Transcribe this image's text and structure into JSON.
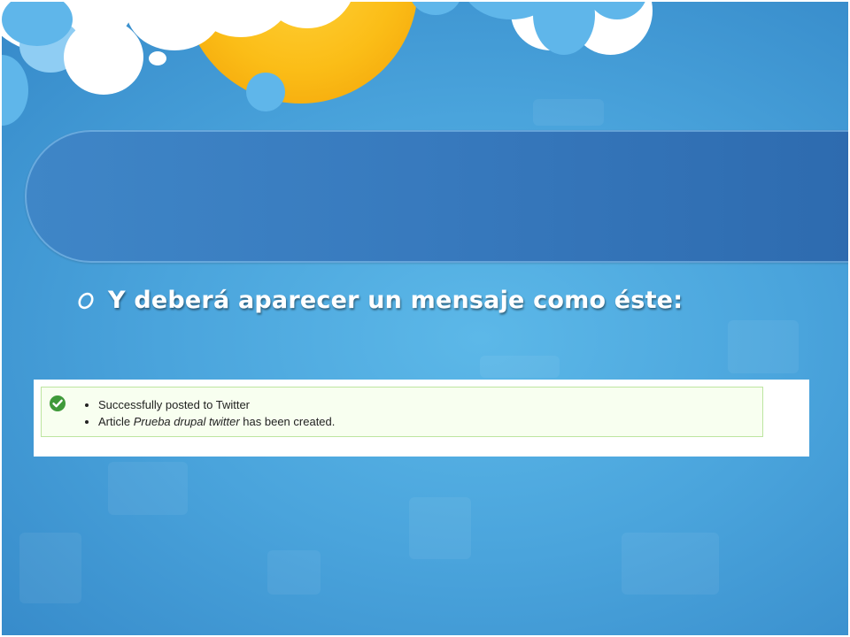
{
  "slide": {
    "bullet_text": "Y deberá aparecer un mensaje como éste:",
    "bullet_icon": "ring-bullet-icon"
  },
  "message": {
    "status_icon": "check-circle-icon",
    "items": [
      {
        "before": "Successfully posted to Twitter",
        "emphasis": "",
        "after": ""
      },
      {
        "before": "Article ",
        "emphasis": "Prueba drupal twitter",
        "after": " has been created."
      }
    ]
  },
  "colors": {
    "background": "#4aa4dc",
    "title_band": "#3779bd",
    "sun": "#fbbd17",
    "message_bg": "#f8fff0",
    "message_border": "#bde5a0",
    "check": "#3f9a3a"
  }
}
